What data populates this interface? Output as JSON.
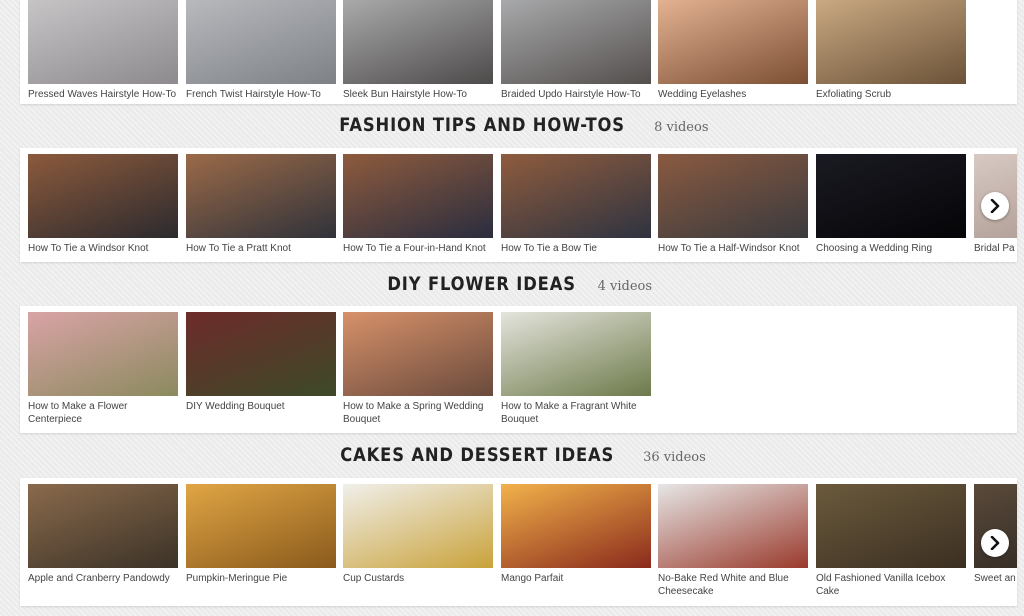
{
  "sections": [
    {
      "title": "",
      "count": "",
      "videos": [
        {
          "title": "Pressed Waves Hairstyle How-To",
          "colors": [
            "#c7c4c6",
            "#8d8a8e"
          ]
        },
        {
          "title": "French Twist Hairstyle How-To",
          "colors": [
            "#b7b9bd",
            "#7e8186"
          ]
        },
        {
          "title": "Sleek Bun Hairstyle How-To",
          "colors": [
            "#aaaaab",
            "#4d4a4a"
          ]
        },
        {
          "title": "Braided Updo Hairstyle How-To",
          "colors": [
            "#a8a9ab",
            "#544f4d"
          ]
        },
        {
          "title": "Wedding Eyelashes",
          "colors": [
            "#e2b292",
            "#7c4e33"
          ]
        },
        {
          "title": "Exfoliating Scrub",
          "colors": [
            "#c9a982",
            "#6b5238"
          ]
        }
      ]
    },
    {
      "title": "FASHION TIPS AND HOW-TOS",
      "count": "8 videos",
      "videos": [
        {
          "title": "How To Tie a Windsor Knot",
          "colors": [
            "#8c5a3c",
            "#2c2a2e"
          ]
        },
        {
          "title": "How To Tie a Pratt Knot",
          "colors": [
            "#9b6a48",
            "#30323a"
          ]
        },
        {
          "title": "How To Tie a Four-in-Hand Knot",
          "colors": [
            "#8e5b3d",
            "#2a2d3f"
          ]
        },
        {
          "title": "How To Tie a Bow Tie",
          "colors": [
            "#8f5c3e",
            "#2e3340"
          ]
        },
        {
          "title": "How To Tie a Half-Windsor Knot",
          "colors": [
            "#8a5a40",
            "#3a3a3e"
          ]
        },
        {
          "title": "Choosing a Wedding Ring",
          "colors": [
            "#1a1a22",
            "#050508"
          ]
        },
        {
          "title": "Bridal Pa",
          "colors": [
            "#d8c9c4",
            "#a59388"
          ]
        }
      ]
    },
    {
      "title": "DIY FLOWER IDEAS",
      "count": "4 videos",
      "videos": [
        {
          "title": "How to Make a Flower Centerpiece",
          "colors": [
            "#d9a3a6",
            "#8b8a5e"
          ]
        },
        {
          "title": "DIY Wedding Bouquet",
          "colors": [
            "#6e2b2a",
            "#3c4a28"
          ]
        },
        {
          "title": "How to Make a Spring Wedding Bouquet",
          "colors": [
            "#d7916a",
            "#6a4a3c"
          ]
        },
        {
          "title": "How to Make a Fragrant White Bouquet",
          "colors": [
            "#e4e4dc",
            "#6d7a4a"
          ]
        }
      ]
    },
    {
      "title": "CAKES AND DESSERT IDEAS",
      "count": "36 videos",
      "videos": [
        {
          "title": "Apple and Cranberry Pandowdy",
          "colors": [
            "#8a6a4c",
            "#3b3227"
          ]
        },
        {
          "title": "Pumpkin-Meringue Pie",
          "colors": [
            "#e0a544",
            "#8a5a1c"
          ]
        },
        {
          "title": "Cup Custards",
          "colors": [
            "#f0efea",
            "#c9a23a"
          ]
        },
        {
          "title": "Mango Parfait",
          "colors": [
            "#f2b24a",
            "#8a2a1c"
          ]
        },
        {
          "title": "No-Bake Red White and Blue Cheesecake",
          "colors": [
            "#e6e6e6",
            "#9a3a2c"
          ]
        },
        {
          "title": "Old Fashioned Vanilla Icebox Cake",
          "colors": [
            "#6b5a3c",
            "#3b2f22"
          ]
        },
        {
          "title": "Sweet an Doughs",
          "colors": [
            "#5a4a3a",
            "#2a2420"
          ]
        }
      ]
    }
  ],
  "controls": {
    "next_icon": "chevron-right-icon"
  }
}
